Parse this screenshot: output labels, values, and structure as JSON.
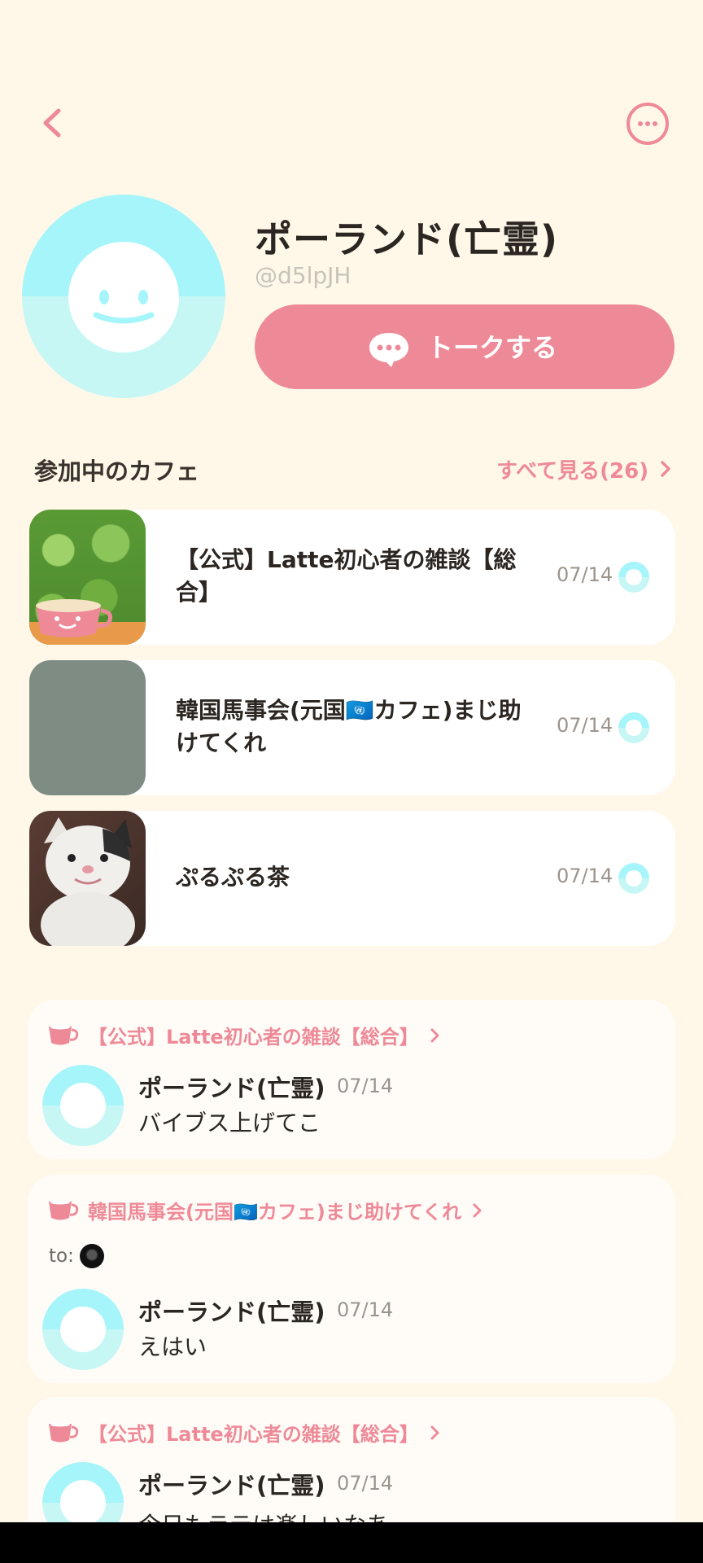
{
  "profile": {
    "name": "ポーランド(亡霊)",
    "handle": "@d5lpJH",
    "talk_button_label": "トークする"
  },
  "cafes_section": {
    "title": "参加中のカフェ",
    "see_all": "すべて見る(26)",
    "items": [
      {
        "name": "【公式】Latte初心者の雑談【総合】",
        "date": "07/14",
        "thumb": "green-foliage-with-latte-cup"
      },
      {
        "name": "韓国馬事会(元国🇺🇳カフェ)まじ助けてくれ",
        "date": "07/14",
        "thumb": "gray-placeholder"
      },
      {
        "name": "ぷるぷる茶",
        "date": "07/14",
        "thumb": "smiling-cat-photo"
      }
    ]
  },
  "posts": [
    {
      "cafe": "【公式】Latte初心者の雑談【総合】",
      "author": "ポーランド(亡霊)",
      "date": "07/14",
      "text": "バイブス上げてこ"
    },
    {
      "cafe": "韓国馬事会(元国🇺🇳カフェ)まじ助けてくれ",
      "to_label": "to:",
      "author": "ポーランド(亡霊)",
      "date": "07/14",
      "text": "えはい"
    },
    {
      "cafe": "【公式】Latte初心者の雑談【総合】",
      "author": "ポーランド(亡霊)",
      "date": "07/14",
      "text": "今日もラテは楽しいなあ"
    }
  ],
  "colors": {
    "background": "#FFF8E9",
    "accent": "#EE8A97",
    "avatar_top": "#A6F5FA",
    "avatar_bottom": "#C7F7F5"
  }
}
